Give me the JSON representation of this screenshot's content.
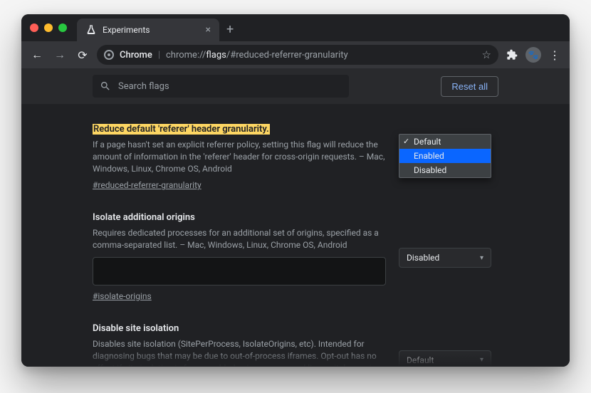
{
  "tab": {
    "title": "Experiments"
  },
  "address": {
    "label": "Chrome",
    "prefix": "chrome://",
    "bold": "flags",
    "suffix": "/#reduced-referrer-granularity"
  },
  "search": {
    "placeholder": "Search flags"
  },
  "reset_label": "Reset all",
  "dropdown_options": {
    "default": "Default",
    "enabled": "Enabled",
    "disabled": "Disabled"
  },
  "flags": [
    {
      "title": "Reduce default 'referer' header granularity.",
      "desc": "If a page hasn't set an explicit referrer policy, setting this flag will reduce the amount of information in the 'referer' header for cross-origin requests. – Mac, Windows, Linux, Chrome OS, Android",
      "anchor": "#reduced-referrer-granularity",
      "highlighted": true,
      "select_value": "Default",
      "dropdown_open": true,
      "dropdown_selected": "Enabled"
    },
    {
      "title": "Isolate additional origins",
      "desc": "Requires dedicated processes for an additional set of origins, specified as a comma-separated list. – Mac, Windows, Linux, Chrome OS, Android",
      "anchor": "#isolate-origins",
      "has_textarea": true,
      "select_value": "Disabled"
    },
    {
      "title": "Disable site isolation",
      "desc": "Disables site isolation (SitePerProcess, IsolateOrigins, etc). Intended for diagnosing bugs that may be due to out-of-process iframes. Opt-out has no effect if site isolation is force-enabled using a command line switch or using an enterprise policy. Caution: this disables",
      "select_value": "Default"
    }
  ]
}
